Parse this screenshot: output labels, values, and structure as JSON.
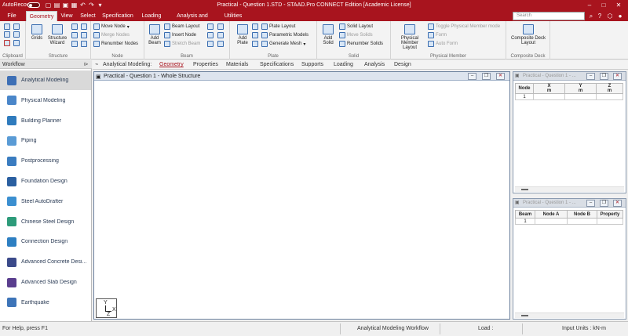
{
  "titlebar": {
    "autorecovery_label": "AutoRecovery",
    "toggle_state": "OFF",
    "title": "Practical - Question 1.STD - STAAD.Pro CONNECT Edition [Academic License]",
    "accent_color": "#a8141e"
  },
  "menu": {
    "tabs": [
      "File",
      "Geometry",
      "View",
      "Select",
      "Specification",
      "Loading",
      "Analysis and Design",
      "Utilities"
    ],
    "active": "Geometry",
    "search_placeholder": "Search"
  },
  "ribbon": {
    "groups": {
      "clipboard": "Clipboard",
      "structure": "Structure",
      "node": "Node",
      "beam": "Beam",
      "plate": "Plate",
      "solid": "Solid",
      "physical_member": "Physical Member",
      "composite_deck": "Composite Deck"
    },
    "grids": "Grids",
    "structure_wizard": "Structure Wizard",
    "move_node": "Move Node",
    "merge_nodes": "Merge Nodes",
    "renumber_nodes": "Renumber Nodes",
    "add_beam": "Add Beam",
    "beam_layout": "Beam Layout",
    "insert_node": "Insert Node",
    "stretch_beam": "Stretch Beam",
    "add_plate": "Add Plate",
    "plate_layout": "Plate Layout",
    "parametric_models": "Parametric Models",
    "generate_mesh": "Generate Mesh",
    "add_solid": "Add Solid",
    "solid_layout": "Solid Layout",
    "move_solids": "Move Solids",
    "renumber_solids": "Renumber Solids",
    "physical_member_layout": "Physical Member Layout",
    "toggle_physical_member_mode": "Toggle Physical Member mode",
    "form": "Form",
    "auto_form": "Auto Form",
    "composite_deck_layout": "Composite Deck Layout"
  },
  "workflow": {
    "header": "Workflow",
    "items": [
      {
        "label": "Analytical Modeling",
        "icon": "analytical-modeling-icon",
        "color": "#3d6fb5"
      },
      {
        "label": "Physical Modeling",
        "icon": "physical-modeling-icon",
        "color": "#4a86c9"
      },
      {
        "label": "Building Planner",
        "icon": "building-planner-icon",
        "color": "#2f7bbd"
      },
      {
        "label": "Piping",
        "icon": "piping-icon",
        "color": "#5a9bd5"
      },
      {
        "label": "Postprocessing",
        "icon": "postprocessing-icon",
        "color": "#3a7cc0"
      },
      {
        "label": "Foundation Design",
        "icon": "foundation-design-icon",
        "color": "#2a5fa0"
      },
      {
        "label": "Steel AutoDrafter",
        "icon": "steel-autodrafter-icon",
        "color": "#3b8fd0"
      },
      {
        "label": "Chinese Steel Design",
        "icon": "chinese-steel-design-icon",
        "color": "#2d9b7a"
      },
      {
        "label": "Connection Design",
        "icon": "connection-design-icon",
        "color": "#2d7fc2"
      },
      {
        "label": "Advanced Concrete Desi...",
        "icon": "advanced-concrete-design-icon",
        "color": "#3b4a8a"
      },
      {
        "label": "Advanced Slab Design",
        "icon": "advanced-slab-design-icon",
        "color": "#5a3e8e"
      },
      {
        "label": "Earthquake",
        "icon": "earthquake-icon",
        "color": "#3d74b8"
      }
    ],
    "selected": "Analytical Modeling"
  },
  "pagebar": {
    "prefix": "Analytical Modeling:",
    "tabs": [
      "Geometry",
      "Properties",
      "Materials",
      "Specifications",
      "Supports",
      "Loading",
      "Analysis",
      "Design"
    ],
    "active": "Geometry"
  },
  "main_window": {
    "title": "Practical - Question 1 - Whole Structure",
    "axis_labels": [
      "Y",
      "X",
      "Z"
    ]
  },
  "node_table": {
    "title": "Practical - Question 1 - ...",
    "columns": [
      "Node",
      "X\nm",
      "Y\nm",
      "Z\nm"
    ],
    "col_labels": [
      "Node",
      "X",
      "Y",
      "Z"
    ],
    "units": [
      "",
      "m",
      "m",
      "m"
    ],
    "rows": [
      [
        "1",
        "",
        "",
        ""
      ]
    ]
  },
  "beam_table": {
    "title": "Practical - Question 1 - ...",
    "columns": [
      "Beam",
      "Node A",
      "Node B",
      "Property"
    ],
    "rows": [
      [
        "1",
        "",
        "",
        ""
      ]
    ]
  },
  "status": {
    "help": "For Help, press F1",
    "workflow": "Analytical Modeling Workflow",
    "load": "Load :",
    "units": "Input Units : kN-m"
  }
}
